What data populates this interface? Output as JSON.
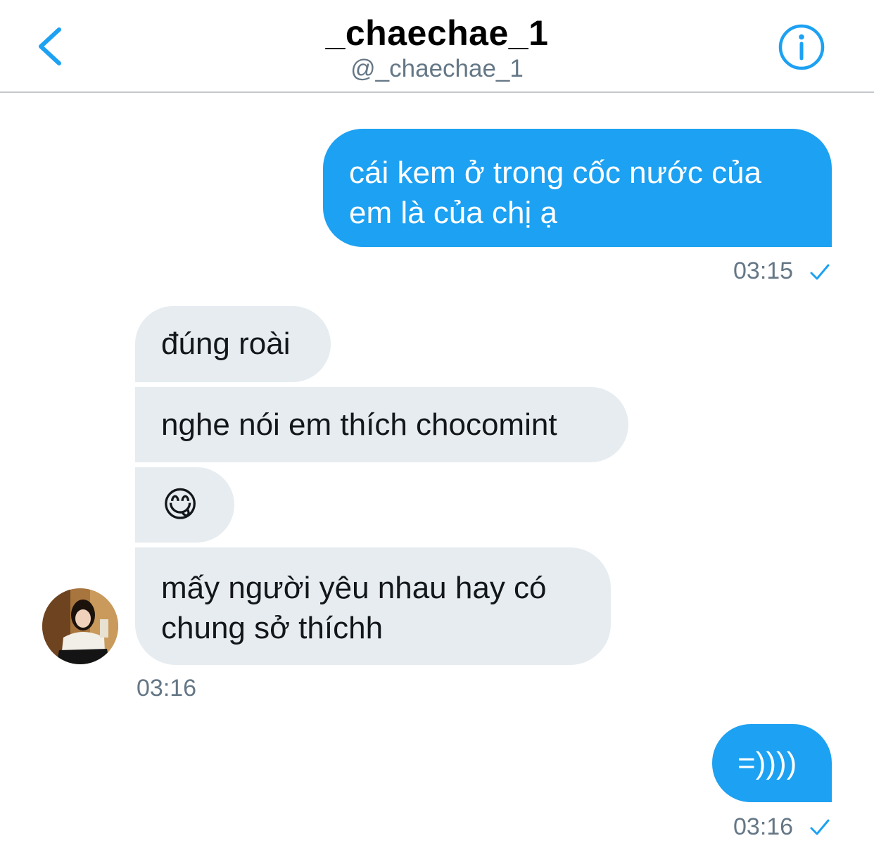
{
  "header": {
    "display_name": "_chaechae_1",
    "handle": "@_chaechae_1",
    "back_icon": "chevron-left-icon",
    "info_icon": "info-circle-icon",
    "accent_color": "#1da1f2"
  },
  "conversation": {
    "messages": [
      {
        "direction": "outgoing",
        "text": "cái kem ở trong cốc nước của\nem là của chị ạ"
      },
      {
        "direction": "incoming",
        "text": "đúng roài"
      },
      {
        "direction": "incoming",
        "text": "nghe nói em thích chocomint"
      },
      {
        "direction": "incoming",
        "text": "😋"
      },
      {
        "direction": "incoming",
        "text": "mấy người yêu nhau hay có\nchung sở thíchh"
      },
      {
        "direction": "outgoing",
        "text": "=))))"
      }
    ],
    "timestamps": {
      "first_outgoing": "03:15",
      "incoming_group": "03:16",
      "last_outgoing": "03:16"
    },
    "read_receipt_icon": "checkmark-icon"
  },
  "colors": {
    "outgoing_bubble": "#1da1f2",
    "incoming_bubble": "#e6ecf0",
    "timestamp": "#657786"
  }
}
